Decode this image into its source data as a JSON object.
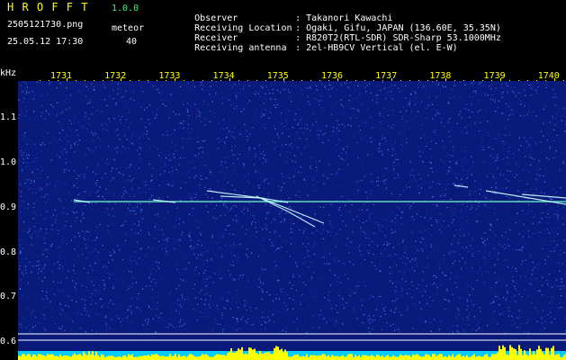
{
  "header": {
    "app_name": "H R O F F T",
    "version": "1.0.0",
    "filename": "2505121730.png",
    "timestamp": "25.05.12 17:30",
    "meteor_label": "meteor",
    "meteor_count": "40",
    "info": [
      {
        "label": "Observer",
        "value": "Takanori Kawachi"
      },
      {
        "label": "Receiving Location",
        "value": "Ogaki, Gifu, JAPAN (136.60E, 35.35N)"
      },
      {
        "label": "Receiver",
        "value": "R820T2(RTL-SDR) SDR-Sharp 53.1000MHz"
      },
      {
        "label": "Receiving antenna",
        "value": "2el-HB9CV Vertical (el. E-W)"
      }
    ]
  },
  "axis": {
    "unit": "kHz",
    "time_labels": [
      "1731",
      "1732",
      "1733",
      "1734",
      "1735",
      "1736",
      "1737",
      "1738",
      "1739",
      "1740"
    ],
    "freq_labels": [
      "1.1",
      "1.0",
      "0.9",
      "0.8",
      "0.7",
      "0.6"
    ]
  },
  "colors": {
    "background": "#000000",
    "spectrum_bg": "#0a1a7a",
    "text_yellow": "#ffff00",
    "text_green": "#33ff66",
    "text_white": "#ffffff",
    "carrier_line": "#66ffcc",
    "meteor_trail": "#ccffff",
    "level_fill": "#ffff00",
    "level_low": "#00ccff"
  }
}
